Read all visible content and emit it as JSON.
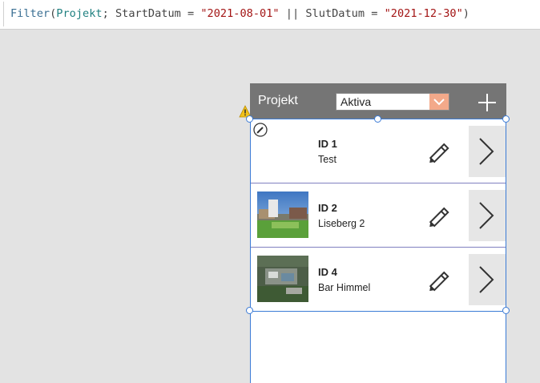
{
  "formula": {
    "fn": "Filter",
    "open": "(",
    "table": "Projekt",
    "sep": "; ",
    "field1": "StartDatum",
    "eq1": " = ",
    "value1": "\"2021-08-01\"",
    "or": " || ",
    "field2": "SlutDatum",
    "eq2": " = ",
    "value2": "\"2021-12-30\"",
    "close": ")"
  },
  "header": {
    "title": "Projekt",
    "filter_value": "Aktiva",
    "add_icon": "plus-icon"
  },
  "gallery": {
    "items": [
      {
        "id": "ID 1",
        "name": "Test",
        "has_image": false
      },
      {
        "id": "ID 2",
        "name": "Liseberg 2",
        "has_image": true
      },
      {
        "id": "ID 4",
        "name": "Bar Himmel",
        "has_image": true
      }
    ]
  },
  "colors": {
    "header_bg": "#757575",
    "dropdown_accent": "#f3a98a",
    "selection": "#3b7bd6",
    "warning": "#f2c21b"
  }
}
